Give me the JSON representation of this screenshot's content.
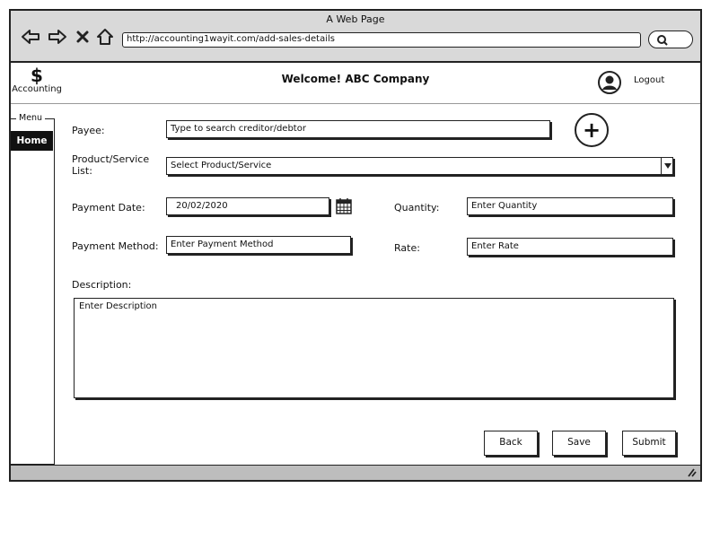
{
  "window": {
    "title": "A Web Page",
    "url": "http://accounting1wayit.com/add-sales-details"
  },
  "header": {
    "logo_symbol": "$",
    "logo_label": "Accounting",
    "welcome": "Welcome! ABC Company",
    "logout": "Logout"
  },
  "sidebar": {
    "menu_label": "Menu",
    "items": [
      {
        "label": "Home",
        "active": true
      }
    ]
  },
  "form": {
    "payee": {
      "label": "Payee:",
      "placeholder": "Type to search creditor/debtor"
    },
    "product": {
      "label_line1": "Product/Service",
      "label_line2": "List:",
      "value": "Select Product/Service"
    },
    "payment_date": {
      "label": "Payment Date:",
      "value": "20/02/2020"
    },
    "quantity": {
      "label": "Quantity:",
      "placeholder": "Enter Quantity"
    },
    "payment_method": {
      "label": "Payment Method:",
      "placeholder": "Enter Payment Method"
    },
    "rate": {
      "label": "Rate:",
      "placeholder": "Enter Rate"
    },
    "description": {
      "label": "Description:",
      "placeholder": "Enter Description"
    }
  },
  "buttons": {
    "add": "+",
    "back": "Back",
    "save": "Save",
    "submit": "Submit"
  },
  "icons": [
    "back-arrow-icon",
    "forward-arrow-icon",
    "close-icon",
    "home-icon",
    "search-icon",
    "user-icon",
    "calendar-icon",
    "dropdown-arrow-icon",
    "resize-grip-icon"
  ]
}
